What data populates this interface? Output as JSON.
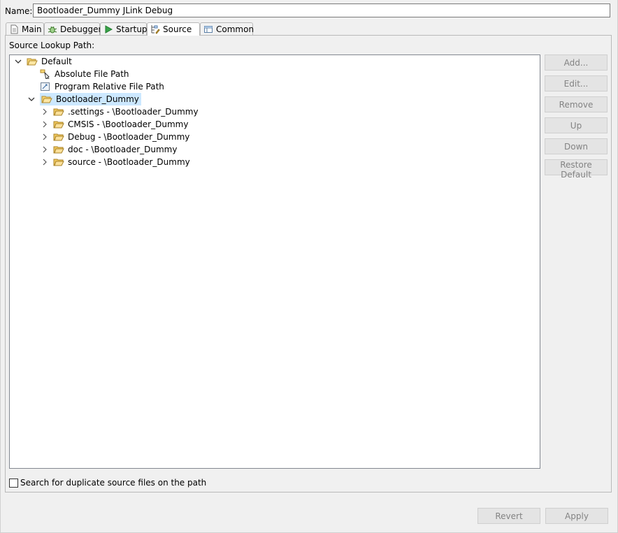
{
  "name": {
    "label": "Name:",
    "value": "Bootloader_Dummy JLink Debug"
  },
  "tabs": [
    {
      "label": "Main",
      "icon": "document-icon"
    },
    {
      "label": "Debugger",
      "icon": "bug-icon"
    },
    {
      "label": "Startup",
      "icon": "play-icon"
    },
    {
      "label": "Source",
      "icon": "source-lookup-icon",
      "active": true
    },
    {
      "label": "Common",
      "icon": "table-icon"
    }
  ],
  "source_lookup": {
    "label": "Source Lookup Path:",
    "tree": {
      "root": {
        "label": "Default",
        "icon": "open-folder-icon",
        "expanded": true
      },
      "items": [
        {
          "label": "Absolute File Path",
          "icon": "absolute-path-icon"
        },
        {
          "label": "Program Relative File Path",
          "icon": "relative-path-icon"
        },
        {
          "label": "Bootloader_Dummy",
          "icon": "open-folder-icon",
          "expanded": true,
          "selected": true
        }
      ],
      "children": [
        {
          "label": ".settings - \\Bootloader_Dummy",
          "icon": "folder-icon"
        },
        {
          "label": "CMSIS - \\Bootloader_Dummy",
          "icon": "folder-icon"
        },
        {
          "label": "Debug - \\Bootloader_Dummy",
          "icon": "folder-icon"
        },
        {
          "label": "doc - \\Bootloader_Dummy",
          "icon": "folder-icon"
        },
        {
          "label": "source - \\Bootloader_Dummy",
          "icon": "folder-icon"
        }
      ]
    },
    "buttons": {
      "add": "Add...",
      "edit": "Edit...",
      "remove": "Remove",
      "up": "Up",
      "down": "Down",
      "restore_default": "Restore Default"
    },
    "duplicate_search": {
      "label": "Search for duplicate source files on the path",
      "checked": false
    }
  },
  "footer": {
    "revert": "Revert",
    "apply": "Apply"
  },
  "colors": {
    "selection": "#cce8ff",
    "disabled_text": "#838383",
    "folder": "#e6b84c"
  }
}
